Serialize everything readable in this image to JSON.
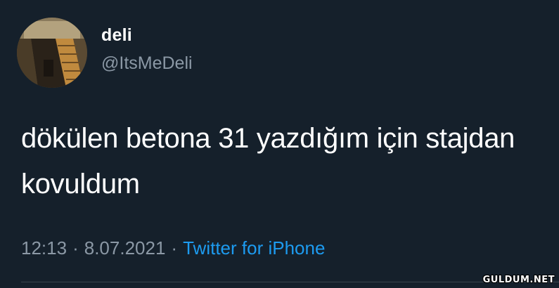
{
  "tweet": {
    "author": {
      "display_name": "deli",
      "handle": "@ItsMeDeli",
      "avatar_icon": "staircase-avatar-photo"
    },
    "text_line1": "dökülen betona 31 yazdığım için stajdan",
    "text_line2": "kovuldum",
    "time": "12:13",
    "date": "8.07.2021",
    "separator": "·",
    "source": "Twitter for iPhone"
  },
  "watermark": "GULDUM.NET",
  "colors": {
    "background": "#15202b",
    "text_primary": "#ffffff",
    "text_secondary": "#8b98a5",
    "link": "#1d9bf0",
    "divider": "#38444d"
  }
}
